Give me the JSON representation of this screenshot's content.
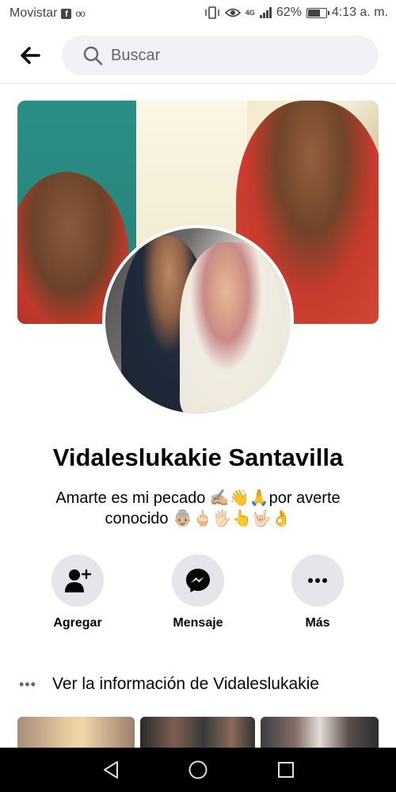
{
  "status_bar": {
    "carrier": "Movistar",
    "network": "4G",
    "battery": "62%",
    "battery_level": 0.62,
    "time": "4:13 a. m."
  },
  "header": {
    "search_placeholder": "Buscar"
  },
  "profile": {
    "name": "Vidaleslukakie Santavilla",
    "bio_line1": "Amarte es mi pecado ✍🏼👋🙏por averte",
    "bio_line2": "conocido 👵🏼🖕🏻🖐🏻👆🤟🏻👌"
  },
  "actions": {
    "add_label": "Agregar",
    "message_label": "Mensaje",
    "more_label": "Más"
  },
  "info": {
    "dots": "•••",
    "text": "Ver la información de Vidaleslukakie"
  },
  "colors": {
    "accent": "#1877f2",
    "button_bg": "#e4e6eb",
    "search_bg": "#f0f2f5"
  }
}
